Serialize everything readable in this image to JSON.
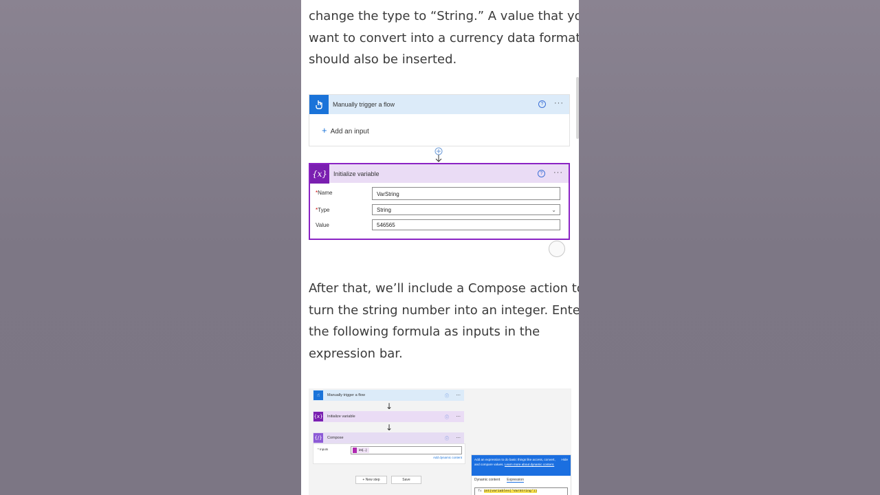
{
  "paragraph1": [
    "change the type to “String.” A value that you",
    "want to convert into a currency data format",
    "should also be inserted."
  ],
  "flow1": {
    "trigger_title": "Manually trigger a flow",
    "add_input": "Add an input",
    "init_title": "Initialize variable",
    "name_label": "Name",
    "type_label": "Type",
    "value_label": "Value",
    "name_value": "VarString",
    "type_value": "String",
    "value_value": "546565",
    "help_glyph": "?",
    "more_glyph": "···",
    "var_glyph": "{x}"
  },
  "paragraph2": [
    "After that, we’ll include a Compose action to",
    "turn the string number into an integer. Enter",
    "the following formula as inputs in the",
    "expression bar."
  ],
  "flow2": {
    "trigger_title": "Manually trigger a flow",
    "init_title": "Initialize variable",
    "compose_title": "Compose",
    "inputs_label": "* Inputs",
    "token_label": "int(...)",
    "add_dynamic": "Add dynamic content",
    "new_step": "+ New step",
    "save": "Save",
    "expr_help": "Add an expression to do basic things like access, convert, and compare values.",
    "expr_learn": "Learn more about dynamic content.",
    "expr_hide": "Hide",
    "tab_dynamic": "Dynamic content",
    "tab_expression": "Expression",
    "expr_text": "int(variables('VarString'))"
  },
  "colors": {
    "trigger_blue": "#1a73d9",
    "variable_purple": "#7a1fb0",
    "panel_blue": "#1b6fe0"
  }
}
